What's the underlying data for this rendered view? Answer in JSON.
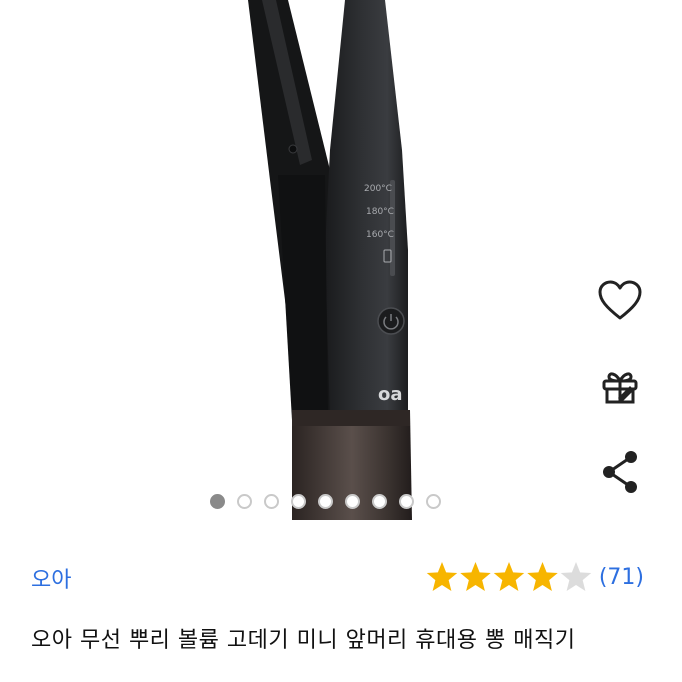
{
  "product": {
    "brand": "오아",
    "title": "오아 무선 뿌리 볼륨 고데기 미니 앞머리 휴대용 뽕 매직기",
    "rating": 4,
    "rating_max": 5,
    "review_count": "(71)",
    "device_labels": {
      "temp_high": "200°C",
      "temp_mid": "180°C",
      "temp_low": "160°C",
      "logo": "oa"
    }
  },
  "carousel": {
    "total_slides": 9,
    "active_index": 0
  },
  "actions": [
    {
      "name": "wishlist-heart-icon"
    },
    {
      "name": "gift-icon"
    },
    {
      "name": "share-icon"
    }
  ],
  "colors": {
    "brand_blue": "#2d6fe0",
    "star_filled": "#f7b500",
    "star_empty": "#dcdcdc",
    "device_body": "#232426",
    "device_tip": "#3a3230"
  }
}
